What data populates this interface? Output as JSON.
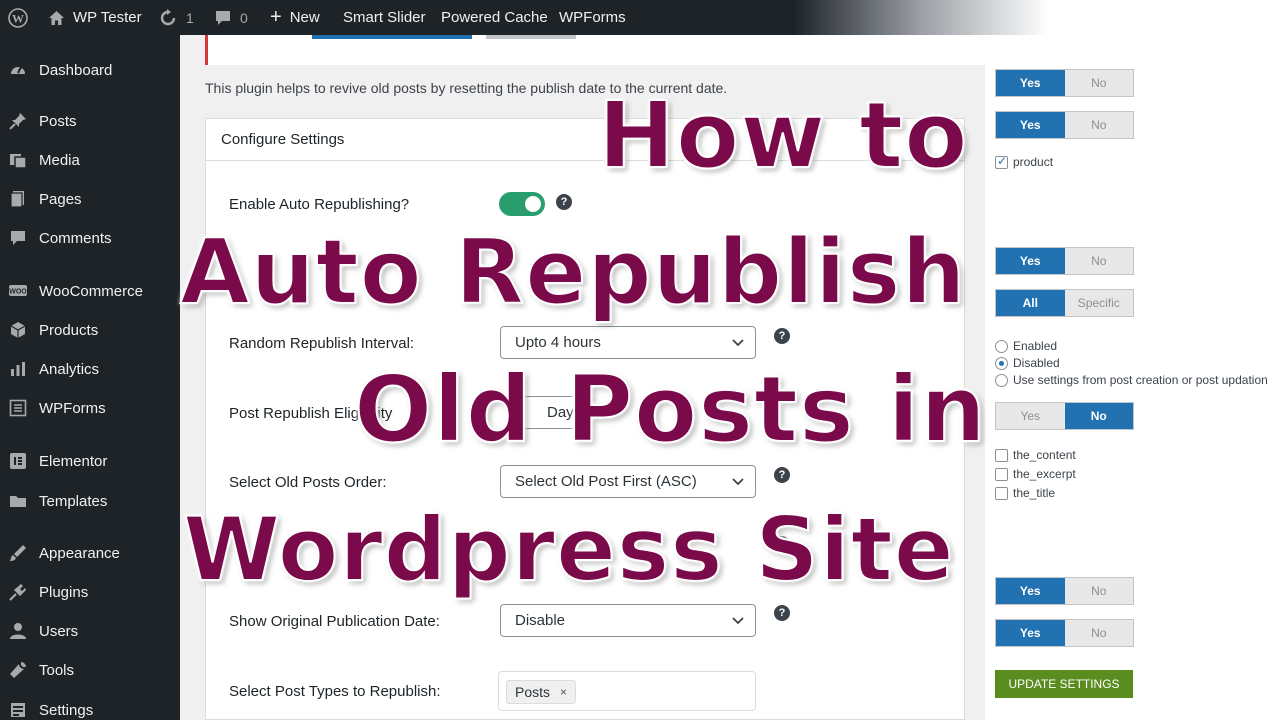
{
  "adminbar": {
    "site_name": "WP Tester",
    "updates_count": "1",
    "comments_count": "0",
    "new_label": "New",
    "items": [
      "Smart Slider",
      "Powered Cache",
      "WPForms"
    ]
  },
  "sidebar": {
    "items": [
      {
        "label": "Dashboard",
        "icon": "dashboard-icon"
      },
      {
        "label": "Posts",
        "icon": "pin-icon"
      },
      {
        "label": "Media",
        "icon": "media-icon"
      },
      {
        "label": "Pages",
        "icon": "pages-icon"
      },
      {
        "label": "Comments",
        "icon": "comments-icon"
      },
      {
        "label": "WooCommerce",
        "icon": "woocommerce-icon"
      },
      {
        "label": "Products",
        "icon": "products-icon"
      },
      {
        "label": "Analytics",
        "icon": "analytics-icon"
      },
      {
        "label": "WPForms",
        "icon": "wpforms-icon"
      },
      {
        "label": "Elementor",
        "icon": "elementor-icon"
      },
      {
        "label": "Templates",
        "icon": "templates-icon"
      },
      {
        "label": "Appearance",
        "icon": "appearance-icon"
      },
      {
        "label": "Plugins",
        "icon": "plugins-icon"
      },
      {
        "label": "Users",
        "icon": "users-icon"
      },
      {
        "label": "Tools",
        "icon": "tools-icon"
      },
      {
        "label": "Settings",
        "icon": "settings-icon"
      }
    ]
  },
  "main": {
    "intro": "This plugin helps to revive old posts by resetting the publish date to the current date.",
    "panel_title": "Configure Settings",
    "rows": {
      "enable_label": "Enable Auto Republishing?",
      "interval_label": "Random Republish Interval:",
      "interval_value": "Upto 4 hours",
      "eligibility_label": "Post Republish Eligibility",
      "eligibility_value": "Days",
      "order_label": "Select Old Posts Order:",
      "order_value": "Select Old Post First (ASC)",
      "show_date_label": "Show Original Publication Date:",
      "show_date_value": "Disable",
      "post_types_label": "Select Post Types to Republish:",
      "post_types_tag": "Posts",
      "help_glyph": "?"
    }
  },
  "right": {
    "seg1": {
      "yes": "Yes",
      "no": "No",
      "active": "yes"
    },
    "seg2": {
      "yes": "Yes",
      "no": "No",
      "active": "yes"
    },
    "product_checkbox": "product",
    "seg3": {
      "yes": "Yes",
      "no": "No",
      "active": "yes"
    },
    "seg4": {
      "all": "All",
      "specific": "Specific",
      "active": "all"
    },
    "radios": [
      "Enabled",
      "Disabled",
      "Use settings from post creation or post updation"
    ],
    "radio_selected": "Disabled",
    "seg5": {
      "yes": "Yes",
      "no": "No",
      "active": "no"
    },
    "checkboxes": [
      "the_content",
      "the_excerpt",
      "the_title"
    ],
    "seg6": {
      "yes": "Yes",
      "no": "No",
      "active": "yes"
    },
    "seg7": {
      "yes": "Yes",
      "no": "No",
      "active": "yes"
    },
    "update_button": "UPDATE SETTINGS"
  },
  "overlay": {
    "line1": "How to",
    "line2": "Auto Republish",
    "line3": "Old Posts in",
    "line4": "Wordpress Site"
  },
  "colors": {
    "overlay_text": "#7a0a4a",
    "toggle_on": "#2a9d6f",
    "segment_active": "#2271b1",
    "update_button": "#5b8c1f"
  }
}
